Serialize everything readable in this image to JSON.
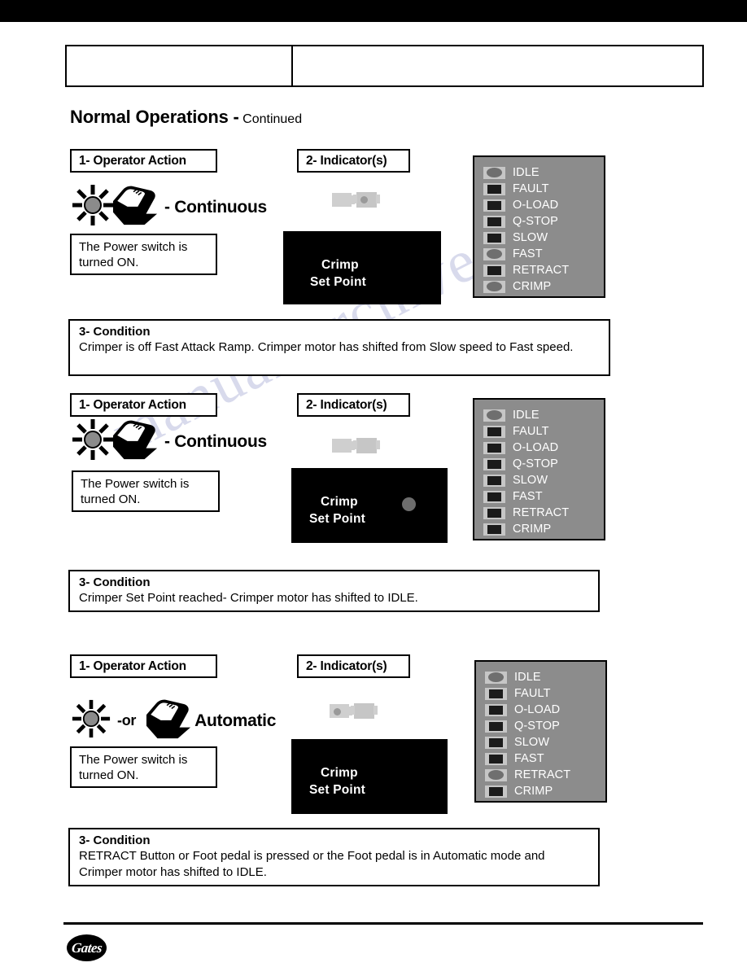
{
  "document": {
    "title_main": "Normal Operations -",
    "title_suffix": "Continued",
    "watermark_line1": "manualsarchive.com",
    "watermark_line2": ""
  },
  "header_table": {
    "left_cell": "",
    "right_cell": ""
  },
  "labels": {
    "operator_action": "1- Operator Action",
    "indicators": "2- Indicator(s)",
    "condition": "3- Condition"
  },
  "lcd": {
    "line1": "Crimp",
    "line2": "Set Point"
  },
  "led_names": [
    "IDLE",
    "FAULT",
    "O-LOAD",
    "Q-STOP",
    "SLOW",
    "FAST",
    "RETRACT",
    "CRIMP"
  ],
  "sections": [
    {
      "action_label": "1- Operator Action",
      "action_mode": "- Continuous",
      "action_note": "The Power switch is turned ON.",
      "indicator_label": "2- Indicator(s)",
      "lcd_line1": "Crimp",
      "lcd_line2": "Set Point",
      "lcd_dot_visible": false,
      "led_states": [
        "on",
        "off",
        "off",
        "off",
        "off",
        "on",
        "off",
        "on"
      ],
      "condition_title": "3- Condition",
      "condition_text": "Crimper is off Fast Attack Ramp. Crimper motor has shifted from Slow speed to Fast speed."
    },
    {
      "action_label": "1- Operator Action",
      "action_mode": "- Continuous",
      "action_note": "The Power switch is turned ON.",
      "indicator_label": "2- Indicator(s)",
      "lcd_line1": "Crimp",
      "lcd_line2": "Set Point",
      "lcd_dot_visible": true,
      "led_states": [
        "on",
        "off",
        "off",
        "off",
        "off",
        "off",
        "off",
        "off"
      ],
      "condition_title": "3- Condition",
      "condition_text": "Crimper Set Point reached- Crimper motor has shifted to IDLE."
    },
    {
      "action_label": "1- Operator Action",
      "action_or": "-or",
      "action_mode": "Automatic",
      "action_note": "The Power switch is turned ON.",
      "indicator_label": "2- Indicator(s)",
      "lcd_line1": "Crimp",
      "lcd_line2": "Set Point",
      "lcd_dot_visible": false,
      "led_states": [
        "on",
        "off",
        "off",
        "off",
        "off",
        "off",
        "on",
        "off"
      ],
      "condition_title": "3- Condition",
      "condition_text": "RETRACT Button or Foot pedal is pressed or the Foot pedal is in Automatic mode and Crimper motor has shifted to IDLE."
    }
  ],
  "icons": {
    "sun": "sun-burst-icon",
    "hand": "hand-press-icon"
  },
  "footer": {
    "logo_text": "Gates"
  },
  "colors": {
    "panel_bg": "#8c8c8c",
    "bezel": "#c6c6c6",
    "lamp_off": "#1b1b1b",
    "lamp_on": "#6f6f6f",
    "lcd_bg": "#000000",
    "watermark": "#b9bcdd"
  }
}
